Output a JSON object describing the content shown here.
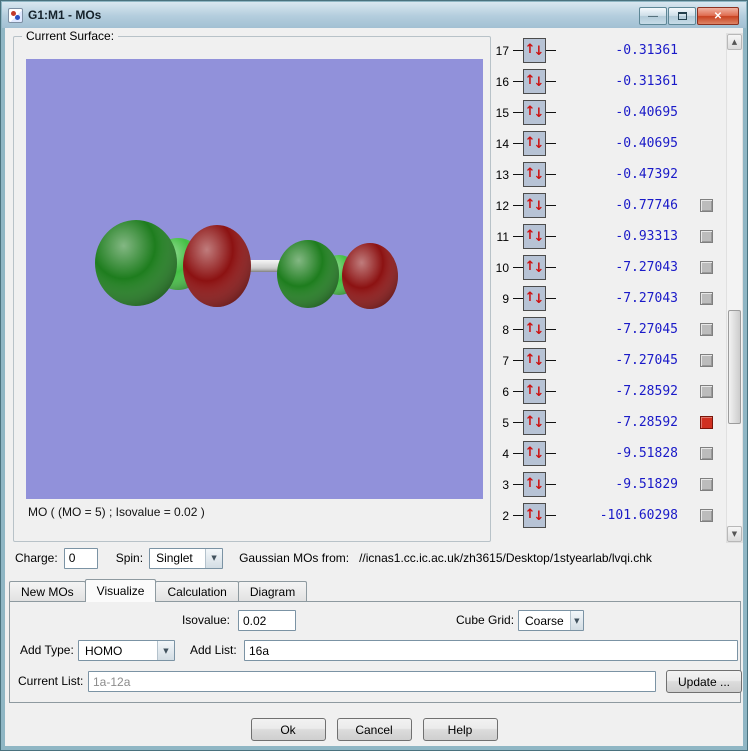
{
  "window": {
    "title": "G1:M1 - MOs"
  },
  "icons": {
    "minimize_glyph": "—",
    "close_glyph": "✕",
    "spin_up": "↑",
    "spin_down": "↓",
    "dropdown_arrow": "▼",
    "scroll_up": "▲",
    "scroll_down": "▼"
  },
  "surface_panel": {
    "label": "Current Surface:",
    "caption": "MO ( (MO = 5) ; Isovalue = 0.02 )"
  },
  "mo_list": {
    "rows": [
      {
        "num": "17",
        "energy": "-0.31361",
        "has_checkbox": false,
        "selected": false
      },
      {
        "num": "16",
        "energy": "-0.31361",
        "has_checkbox": false,
        "selected": false
      },
      {
        "num": "15",
        "energy": "-0.40695",
        "has_checkbox": false,
        "selected": false
      },
      {
        "num": "14",
        "energy": "-0.40695",
        "has_checkbox": false,
        "selected": false
      },
      {
        "num": "13",
        "energy": "-0.47392",
        "has_checkbox": false,
        "selected": false
      },
      {
        "num": "12",
        "energy": "-0.77746",
        "has_checkbox": true,
        "selected": false
      },
      {
        "num": "11",
        "energy": "-0.93313",
        "has_checkbox": true,
        "selected": false
      },
      {
        "num": "10",
        "energy": "-7.27043",
        "has_checkbox": true,
        "selected": false
      },
      {
        "num": "9",
        "energy": "-7.27043",
        "has_checkbox": true,
        "selected": false
      },
      {
        "num": "8",
        "energy": "-7.27045",
        "has_checkbox": true,
        "selected": false
      },
      {
        "num": "7",
        "energy": "-7.27045",
        "has_checkbox": true,
        "selected": false
      },
      {
        "num": "6",
        "energy": "-7.28592",
        "has_checkbox": true,
        "selected": false
      },
      {
        "num": "5",
        "energy": "-7.28592",
        "has_checkbox": true,
        "selected": true
      },
      {
        "num": "4",
        "energy": "-9.51828",
        "has_checkbox": true,
        "selected": false
      },
      {
        "num": "3",
        "energy": "-9.51829",
        "has_checkbox": true,
        "selected": false
      },
      {
        "num": "2",
        "energy": "-101.60298",
        "has_checkbox": true,
        "selected": false
      }
    ]
  },
  "properties_row": {
    "charge_label": "Charge:",
    "charge_value": "0",
    "spin_label": "Spin:",
    "spin_value": "Singlet",
    "source_label": "Gaussian MOs from:",
    "source_path": "//icnas1.cc.ic.ac.uk/zh3615/Desktop/1styearlab/lvqi.chk"
  },
  "tabs": [
    {
      "label": "New MOs",
      "active": false
    },
    {
      "label": "Visualize",
      "active": true
    },
    {
      "label": "Calculation",
      "active": false
    },
    {
      "label": "Diagram",
      "active": false
    }
  ],
  "visualize_tab": {
    "isovalue_label": "Isovalue:",
    "isovalue_value": "0.02",
    "cube_grid_label": "Cube Grid:",
    "cube_grid_value": "Coarse",
    "add_type_label": "Add Type:",
    "add_type_value": "HOMO",
    "add_list_label": "Add List:",
    "add_list_value": "16a",
    "current_list_label": "Current List:",
    "current_list_value": "1a-12a",
    "update_button": "Update ..."
  },
  "footer": {
    "ok_label": "Ok",
    "cancel_label": "Cancel",
    "help_label": "Help"
  },
  "colors": {
    "frame": "#8fb6c4",
    "molecule_bg": "#9191da",
    "lobe_green": "#1e7d1e",
    "lobe_red": "#8c1212",
    "atom_green": "#44c044",
    "bond_gray": "#d2d2d2",
    "energy_text": "#1a1ac8",
    "selected_mo_box": "#d03020",
    "spin_arrow": "#cc1111"
  }
}
